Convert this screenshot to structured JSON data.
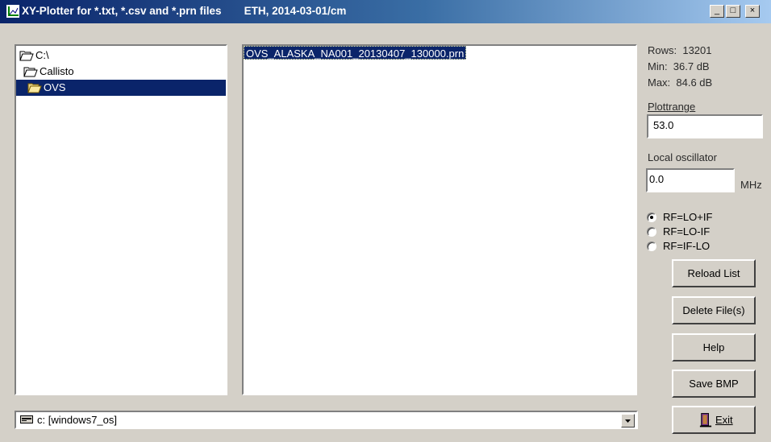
{
  "window": {
    "title": "XY-Plotter for *.txt, *.csv and *.prn files",
    "subtitle": "ETH, 2014-03-01/cm",
    "buttons": {
      "minimize": "_",
      "maximize": "□",
      "close": "×"
    }
  },
  "directories": [
    {
      "label": "C:\\",
      "selected": false
    },
    {
      "label": "Callisto",
      "selected": false
    },
    {
      "label": "OVS",
      "selected": true
    }
  ],
  "files": [
    "OVS_ALASKA_NA001_20130407_130000.prn"
  ],
  "stats": {
    "rows": "Rows:  13201",
    "min": "Min:  36.7 dB",
    "max": "Max:  84.6 dB"
  },
  "plotrange": {
    "label": "Plottrange",
    "value": "53.0"
  },
  "local_oscillator": {
    "label": "Local oscillator",
    "value": "0.0",
    "unit": "MHz"
  },
  "mode_options": [
    {
      "label": "RF=LO+IF",
      "selected": true
    },
    {
      "label": "RF=LO-IF",
      "selected": false
    },
    {
      "label": "RF=IF-LO",
      "selected": false
    }
  ],
  "buttons": {
    "reload": "Reload List",
    "delete": "Delete File(s)",
    "help": "Help",
    "save_bmp": "Save BMP",
    "exit": "Exit"
  },
  "drive": {
    "value": "c: [windows7_os]"
  }
}
